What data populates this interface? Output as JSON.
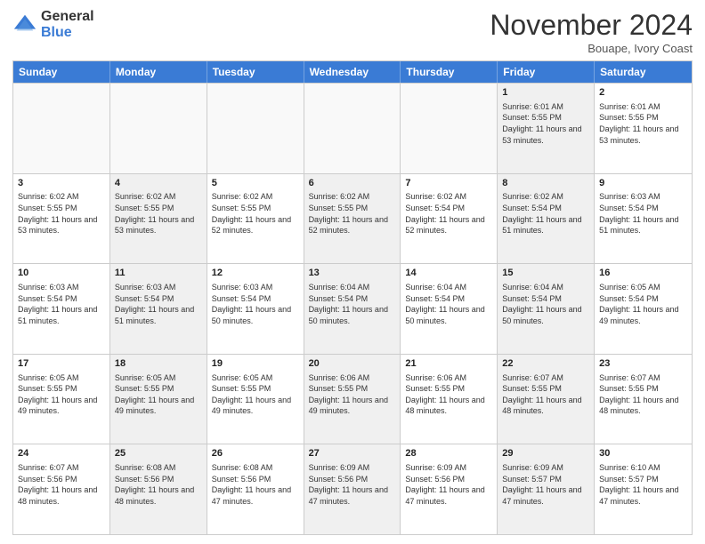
{
  "header": {
    "logo_general": "General",
    "logo_blue": "Blue",
    "month_title": "November 2024",
    "location": "Bouape, Ivory Coast"
  },
  "calendar": {
    "days_of_week": [
      "Sunday",
      "Monday",
      "Tuesday",
      "Wednesday",
      "Thursday",
      "Friday",
      "Saturday"
    ],
    "weeks": [
      [
        {
          "day": "",
          "info": "",
          "empty": true
        },
        {
          "day": "",
          "info": "",
          "empty": true
        },
        {
          "day": "",
          "info": "",
          "empty": true
        },
        {
          "day": "",
          "info": "",
          "empty": true
        },
        {
          "day": "",
          "info": "",
          "empty": true
        },
        {
          "day": "1",
          "info": "Sunrise: 6:01 AM\nSunset: 5:55 PM\nDaylight: 11 hours and 53 minutes.",
          "shaded": true
        },
        {
          "day": "2",
          "info": "Sunrise: 6:01 AM\nSunset: 5:55 PM\nDaylight: 11 hours and 53 minutes.",
          "shaded": false
        }
      ],
      [
        {
          "day": "3",
          "info": "Sunrise: 6:02 AM\nSunset: 5:55 PM\nDaylight: 11 hours and 53 minutes."
        },
        {
          "day": "4",
          "info": "Sunrise: 6:02 AM\nSunset: 5:55 PM\nDaylight: 11 hours and 53 minutes.",
          "shaded": true
        },
        {
          "day": "5",
          "info": "Sunrise: 6:02 AM\nSunset: 5:55 PM\nDaylight: 11 hours and 52 minutes."
        },
        {
          "day": "6",
          "info": "Sunrise: 6:02 AM\nSunset: 5:55 PM\nDaylight: 11 hours and 52 minutes.",
          "shaded": true
        },
        {
          "day": "7",
          "info": "Sunrise: 6:02 AM\nSunset: 5:54 PM\nDaylight: 11 hours and 52 minutes."
        },
        {
          "day": "8",
          "info": "Sunrise: 6:02 AM\nSunset: 5:54 PM\nDaylight: 11 hours and 51 minutes.",
          "shaded": true
        },
        {
          "day": "9",
          "info": "Sunrise: 6:03 AM\nSunset: 5:54 PM\nDaylight: 11 hours and 51 minutes."
        }
      ],
      [
        {
          "day": "10",
          "info": "Sunrise: 6:03 AM\nSunset: 5:54 PM\nDaylight: 11 hours and 51 minutes."
        },
        {
          "day": "11",
          "info": "Sunrise: 6:03 AM\nSunset: 5:54 PM\nDaylight: 11 hours and 51 minutes.",
          "shaded": true
        },
        {
          "day": "12",
          "info": "Sunrise: 6:03 AM\nSunset: 5:54 PM\nDaylight: 11 hours and 50 minutes."
        },
        {
          "day": "13",
          "info": "Sunrise: 6:04 AM\nSunset: 5:54 PM\nDaylight: 11 hours and 50 minutes.",
          "shaded": true
        },
        {
          "day": "14",
          "info": "Sunrise: 6:04 AM\nSunset: 5:54 PM\nDaylight: 11 hours and 50 minutes."
        },
        {
          "day": "15",
          "info": "Sunrise: 6:04 AM\nSunset: 5:54 PM\nDaylight: 11 hours and 50 minutes.",
          "shaded": true
        },
        {
          "day": "16",
          "info": "Sunrise: 6:05 AM\nSunset: 5:54 PM\nDaylight: 11 hours and 49 minutes."
        }
      ],
      [
        {
          "day": "17",
          "info": "Sunrise: 6:05 AM\nSunset: 5:55 PM\nDaylight: 11 hours and 49 minutes."
        },
        {
          "day": "18",
          "info": "Sunrise: 6:05 AM\nSunset: 5:55 PM\nDaylight: 11 hours and 49 minutes.",
          "shaded": true
        },
        {
          "day": "19",
          "info": "Sunrise: 6:05 AM\nSunset: 5:55 PM\nDaylight: 11 hours and 49 minutes."
        },
        {
          "day": "20",
          "info": "Sunrise: 6:06 AM\nSunset: 5:55 PM\nDaylight: 11 hours and 49 minutes.",
          "shaded": true
        },
        {
          "day": "21",
          "info": "Sunrise: 6:06 AM\nSunset: 5:55 PM\nDaylight: 11 hours and 48 minutes."
        },
        {
          "day": "22",
          "info": "Sunrise: 6:07 AM\nSunset: 5:55 PM\nDaylight: 11 hours and 48 minutes.",
          "shaded": true
        },
        {
          "day": "23",
          "info": "Sunrise: 6:07 AM\nSunset: 5:55 PM\nDaylight: 11 hours and 48 minutes."
        }
      ],
      [
        {
          "day": "24",
          "info": "Sunrise: 6:07 AM\nSunset: 5:56 PM\nDaylight: 11 hours and 48 minutes."
        },
        {
          "day": "25",
          "info": "Sunrise: 6:08 AM\nSunset: 5:56 PM\nDaylight: 11 hours and 48 minutes.",
          "shaded": true
        },
        {
          "day": "26",
          "info": "Sunrise: 6:08 AM\nSunset: 5:56 PM\nDaylight: 11 hours and 47 minutes."
        },
        {
          "day": "27",
          "info": "Sunrise: 6:09 AM\nSunset: 5:56 PM\nDaylight: 11 hours and 47 minutes.",
          "shaded": true
        },
        {
          "day": "28",
          "info": "Sunrise: 6:09 AM\nSunset: 5:56 PM\nDaylight: 11 hours and 47 minutes."
        },
        {
          "day": "29",
          "info": "Sunrise: 6:09 AM\nSunset: 5:57 PM\nDaylight: 11 hours and 47 minutes.",
          "shaded": true
        },
        {
          "day": "30",
          "info": "Sunrise: 6:10 AM\nSunset: 5:57 PM\nDaylight: 11 hours and 47 minutes."
        }
      ]
    ]
  }
}
